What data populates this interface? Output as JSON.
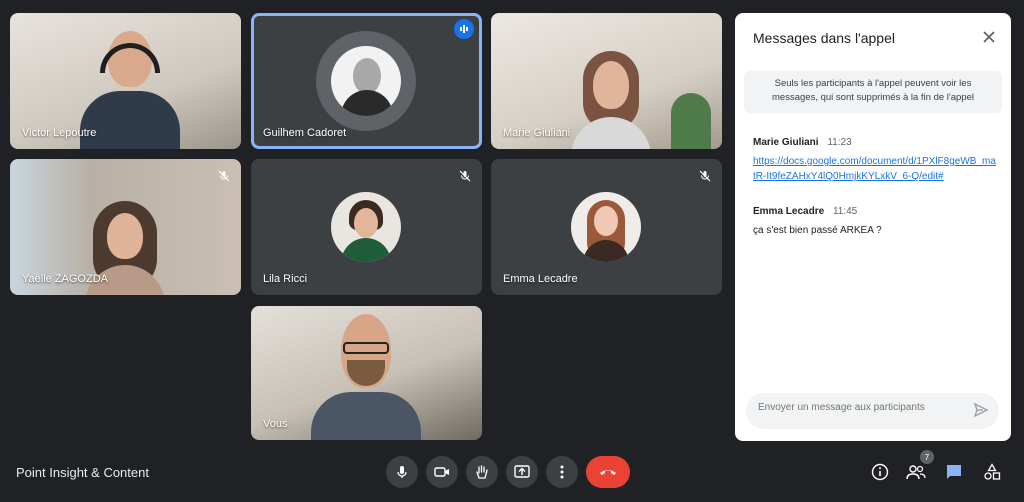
{
  "participants": [
    {
      "name": "Victor Lepoutre",
      "muted": false
    },
    {
      "name": "Guilhem Cadoret",
      "muted": false,
      "speaking": true
    },
    {
      "name": "Marie Giuliani",
      "muted": false
    },
    {
      "name": "Yaëlle ZAGOZDA",
      "muted": true
    },
    {
      "name": "Lila Ricci",
      "muted": true
    },
    {
      "name": "Emma Lecadre",
      "muted": true
    },
    {
      "name": "Vous",
      "muted": false
    }
  ],
  "chat": {
    "title": "Messages dans l'appel",
    "info": "Seuls les participants à l'appel peuvent voir les messages, qui sont supprimés à la fin de l'appel",
    "messages": [
      {
        "sender": "Marie Giuliani",
        "time": "11:23",
        "text": "https://docs.google.com/document/d/1PXlF8geWB_matR-It9feZAHxY4lQ0HmjkKYLxkV_6-Q/edit#",
        "is_link": true
      },
      {
        "sender": "Emma Lecadre",
        "time": "11:45",
        "text": "ça s'est bien passé ARKEA ?",
        "is_link": false
      }
    ],
    "input_placeholder": "Envoyer un message aux participants"
  },
  "meeting": {
    "name": "Point Insight & Content"
  },
  "people_count": "7",
  "colors": {
    "accent": "#1a73e8",
    "end_call": "#ea4335",
    "background": "#202124",
    "tile": "#3c4043"
  }
}
